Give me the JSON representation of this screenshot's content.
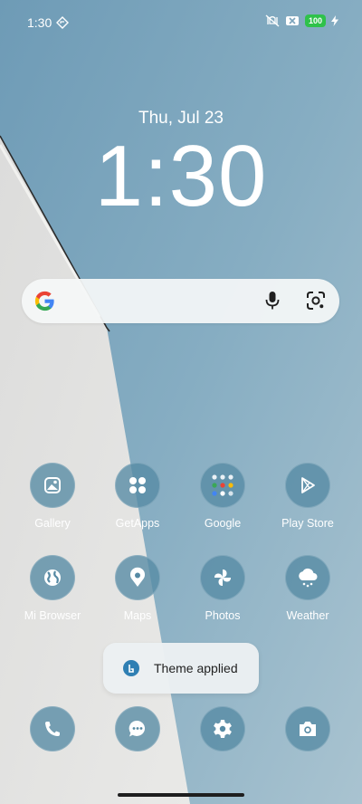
{
  "status_bar": {
    "time": "1:30",
    "battery": "100",
    "icons": [
      "location-diamond-icon",
      "vibrate-off-icon",
      "sim-off-icon",
      "battery-icon",
      "charging-bolt-icon"
    ]
  },
  "clock": {
    "date": "Thu, Jul 23",
    "time": "1:30"
  },
  "search_bar": {
    "icons": [
      "google-g-icon",
      "microphone-icon",
      "google-lens-icon"
    ]
  },
  "apps": [
    {
      "label": "Gallery",
      "icon": "gallery-icon"
    },
    {
      "label": "GetApps",
      "icon": "getapps-icon"
    },
    {
      "label": "Google",
      "icon": "google-folder-icon"
    },
    {
      "label": "Play Store",
      "icon": "play-store-icon"
    },
    {
      "label": "Mi Browser",
      "icon": "globe-icon"
    },
    {
      "label": "Maps",
      "icon": "maps-pin-icon"
    },
    {
      "label": "Photos",
      "icon": "pinwheel-icon"
    },
    {
      "label": "Weather",
      "icon": "weather-cloud-icon"
    }
  ],
  "dock": [
    {
      "icon": "phone-icon"
    },
    {
      "icon": "messages-icon"
    },
    {
      "icon": "settings-gear-icon"
    },
    {
      "icon": "camera-icon"
    }
  ],
  "toast": {
    "text": "Theme applied"
  },
  "colors": {
    "wallpaper_blue": "#6f9db7",
    "wallpaper_light": "#e4e4e2",
    "icon_bg": "#568aa4",
    "battery_green": "#2fc24b"
  }
}
